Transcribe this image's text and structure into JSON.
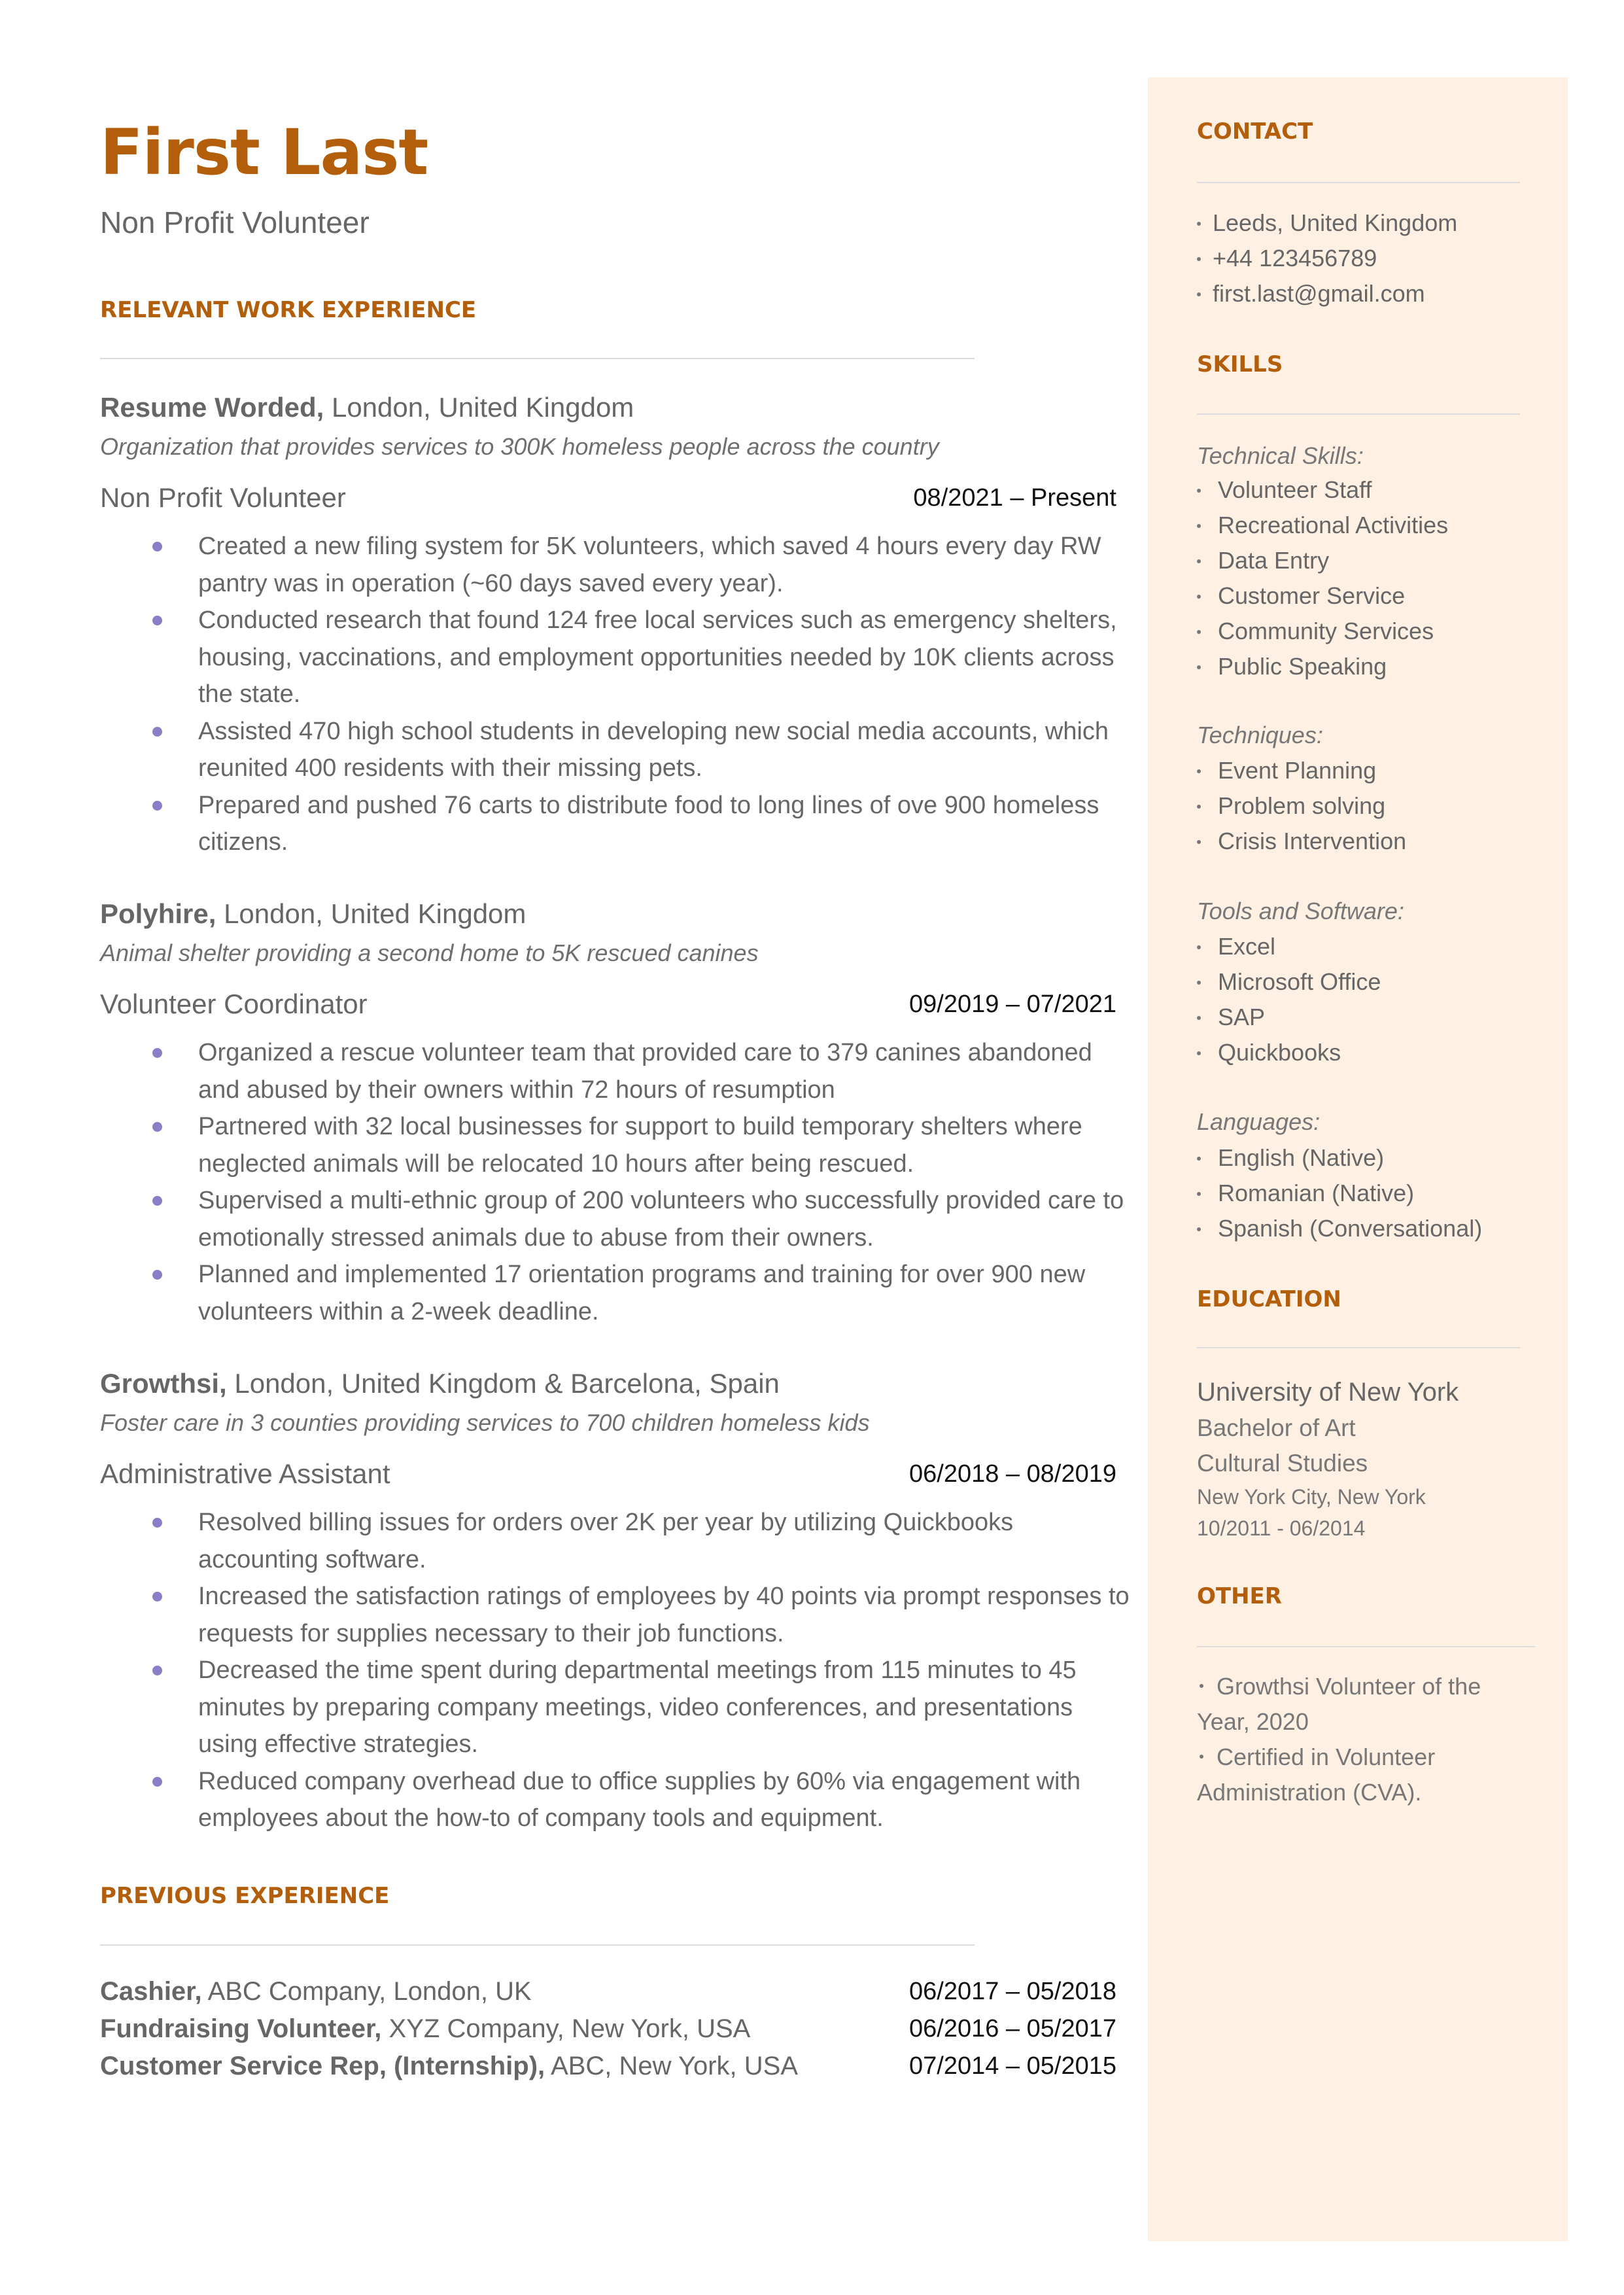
{
  "header": {
    "name": "First Last",
    "title": "Non Profit Volunteer"
  },
  "colors": {
    "accent": "#B35E0A",
    "sidebar_bg": "#FEF0E2",
    "bullet": "#8A7FC6",
    "text": "#666666"
  },
  "sections": {
    "relevant": "RELEVANT WORK EXPERIENCE",
    "previous": "PREVIOUS EXPERIENCE",
    "contact": "CONTACT",
    "skills": "SKILLS",
    "education": "EDUCATION",
    "other": "OTHER"
  },
  "jobs": [
    {
      "company": "Resume Worded,",
      "location": " London, United Kingdom",
      "description": "Organization that provides services to 300K homeless people across the country",
      "role": "Non Profit Volunteer",
      "dates": "08/2021 – Present",
      "bullets": [
        "Created a new filing system for 5K volunteers, which saved 4 hours every day RW pantry was in operation (~60 days saved every year).",
        "Conducted research that found 124 free local services such as emergency shelters, housing, vaccinations, and employment opportunities needed by 10K clients across the state.",
        "Assisted 470 high school students in developing new social media accounts, which reunited 400 residents with their missing pets.",
        "Prepared and pushed 76 carts to distribute food to long lines of ove 900 homeless citizens."
      ]
    },
    {
      "company": "Polyhire,",
      "location": " London, United Kingdom",
      "description": "Animal shelter providing a second home to 5K rescued canines",
      "role": "Volunteer Coordinator",
      "dates": "09/2019 – 07/2021",
      "bullets": [
        "Organized a rescue volunteer team that provided care to 379 canines abandoned and abused by their owners within 72 hours of resumption",
        "Partnered with 32 local businesses for support to build temporary shelters where neglected animals will be relocated 10 hours after being rescued.",
        "Supervised a multi-ethnic group of 200 volunteers who successfully provided care to emotionally stressed animals due to abuse from their owners.",
        "Planned and implemented 17 orientation programs and training for over 900 new volunteers within a 2-week deadline."
      ]
    },
    {
      "company": "Growthsi,",
      "location": " London, United Kingdom & Barcelona, Spain",
      "description": "Foster care in 3 counties providing services to 700 children homeless kids",
      "role": "Administrative Assistant",
      "dates": "06/2018 – 08/2019",
      "bullets": [
        "Resolved billing issues for orders over 2K per year by utilizing Quickbooks accounting software.",
        "Increased the satisfaction ratings of employees by 40 points via prompt responses to requests for supplies necessary to their job functions.",
        "Decreased the time spent during departmental meetings from 115 minutes to 45 minutes by preparing company meetings, video conferences, and presentations using effective strategies.",
        "Reduced company overhead due to office supplies by 60% via engagement with employees about the how-to of company tools and equipment."
      ]
    }
  ],
  "previous": [
    {
      "title": "Cashier,",
      "org": " ABC Company, London, UK",
      "dates": "06/2017 – 05/2018"
    },
    {
      "title": "Fundraising Volunteer,",
      "org": " XYZ Company, New York, USA",
      "dates": "06/2016 – 05/2017"
    },
    {
      "title": "Customer Service Rep, (Internship),",
      "org": " ABC, New York, USA",
      "dates": "07/2014 – 05/2015"
    }
  ],
  "contact": [
    "Leeds, United Kingdom",
    "+44 123456789",
    "first.last@gmail.com"
  ],
  "skills": {
    "technical": {
      "label": "Technical Skills:",
      "items": [
        "Volunteer Staff",
        "Recreational Activities",
        "Data Entry",
        "Customer Service",
        "Community Services",
        "Public Speaking"
      ]
    },
    "techniques": {
      "label": "Techniques:",
      "items": [
        "Event Planning",
        "Problem solving",
        "Crisis Intervention"
      ]
    },
    "tools": {
      "label": "Tools and Software:",
      "items": [
        "Excel",
        "Microsoft Office",
        "SAP",
        "Quickbooks"
      ]
    },
    "languages": {
      "label": "Languages:",
      "items": [
        "English (Native)",
        "Romanian (Native)",
        "Spanish (Conversational)"
      ]
    }
  },
  "education": {
    "school": "University of New York",
    "degree": "Bachelor of Art",
    "field": "Cultural Studies",
    "location": "New York City, New York",
    "dates": "10/2011 - 06/2014"
  },
  "other": [
    "Growthsi Volunteer of the Year, 2020",
    "Certified in Volunteer Administration (CVA)."
  ]
}
